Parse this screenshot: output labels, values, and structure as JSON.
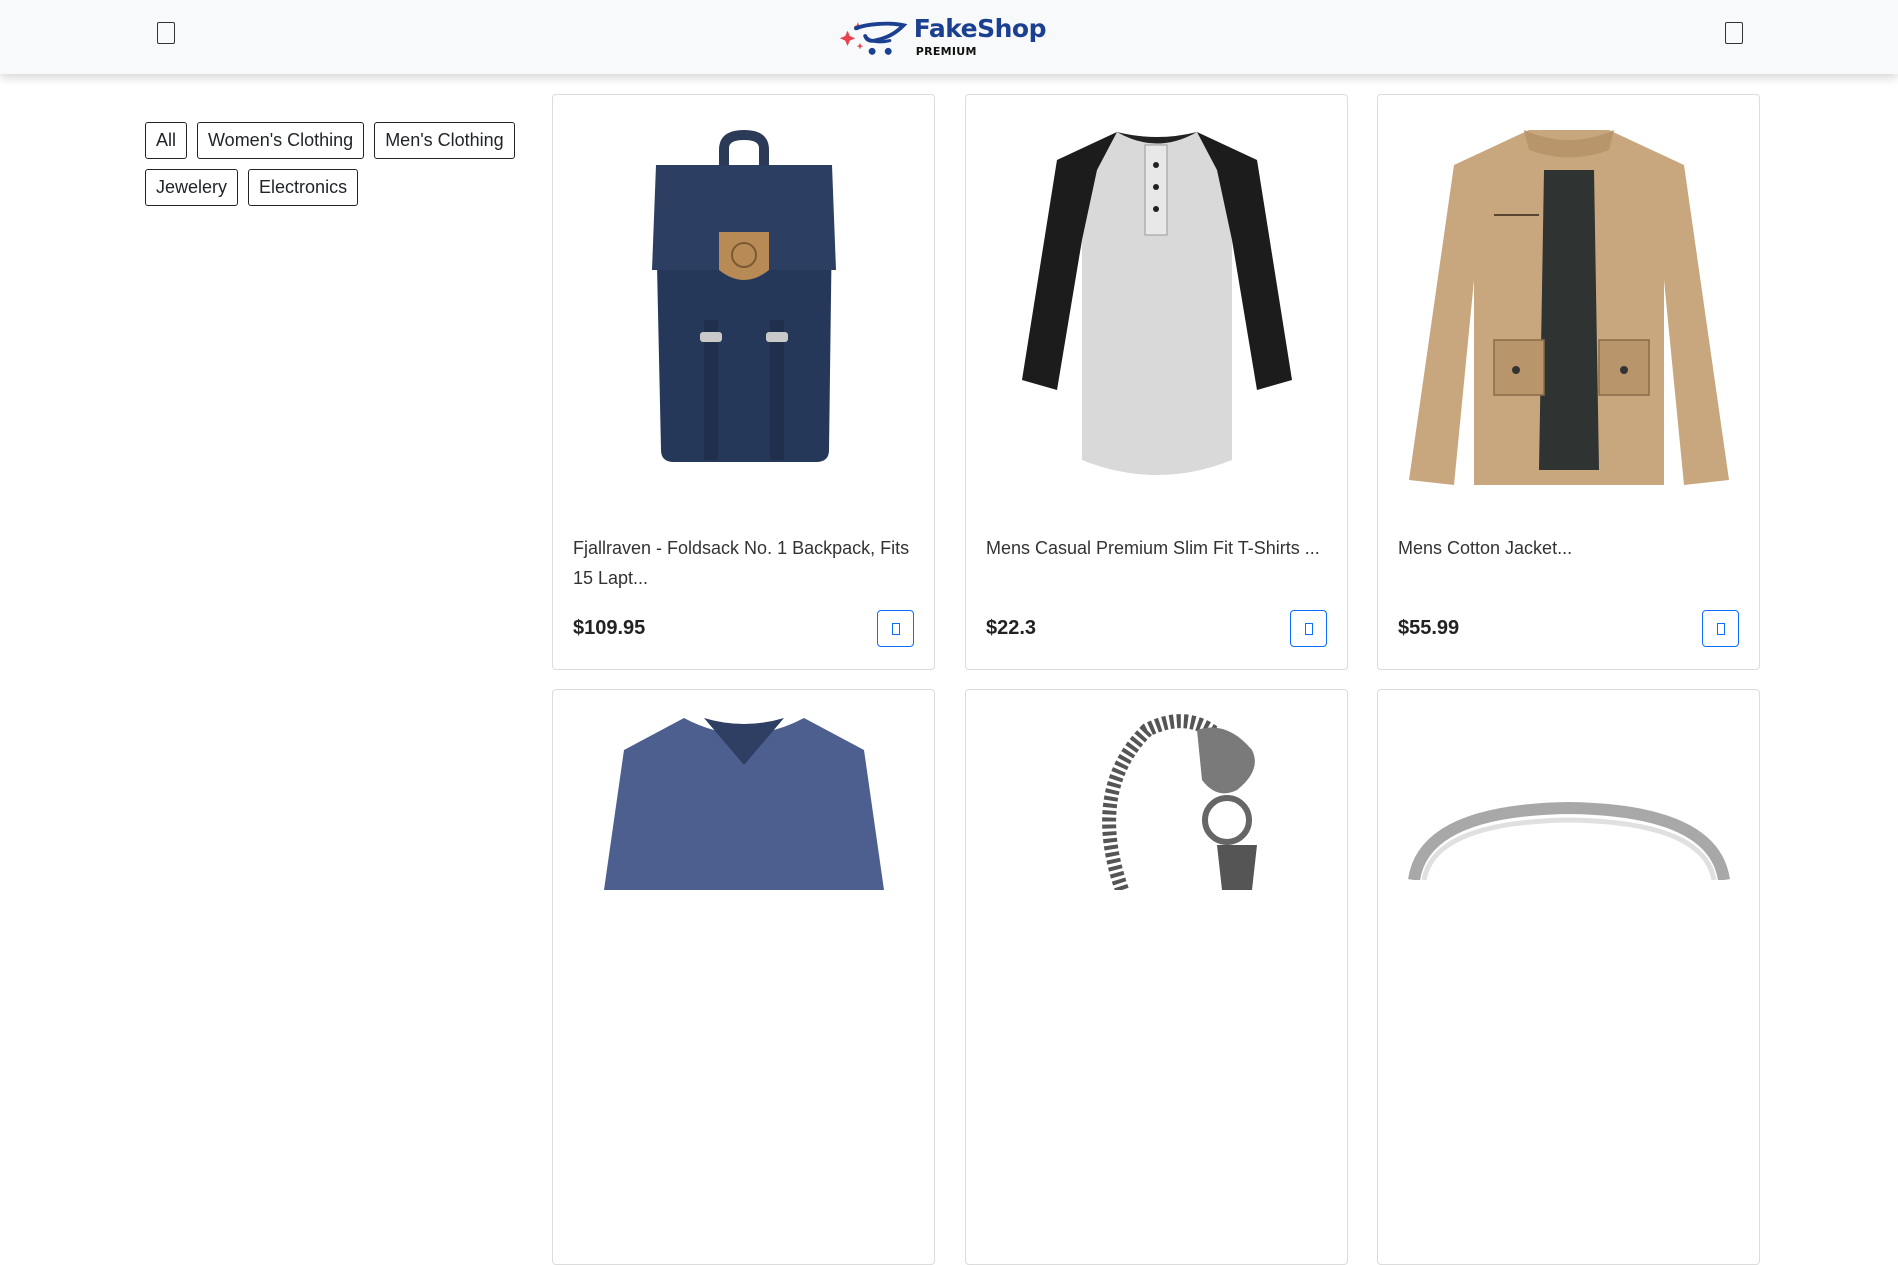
{
  "header": {
    "brand_name": "FakeShop",
    "brand_tagline": "PREMIUM",
    "menu_icon": "menu-icon",
    "cart_icon": "cart-icon",
    "brand_colors": {
      "primary": "#1b3f91",
      "accent": "#e8434d"
    }
  },
  "filters": [
    {
      "label": "All"
    },
    {
      "label": "Women's Clothing"
    },
    {
      "label": "Men's Clothing"
    },
    {
      "label": "Jewelery"
    },
    {
      "label": "Electronics"
    }
  ],
  "products": [
    {
      "title": "Fjallraven - Foldsack No. 1 Backpack, Fits 15 Lapt...",
      "price": "$109.95",
      "image": "navy-backpack"
    },
    {
      "title": "Mens Casual Premium Slim Fit T-Shirts ...",
      "price": "$22.3",
      "image": "raglan-henley-shirt"
    },
    {
      "title": "Mens Cotton Jacket...",
      "price": "$55.99",
      "image": "khaki-jacket"
    },
    {
      "title": "",
      "price": "",
      "image": "blue-vneck-sweater"
    },
    {
      "title": "",
      "price": "",
      "image": "dragon-chain-bracelet"
    },
    {
      "title": "",
      "price": "",
      "image": "silver-ring"
    }
  ],
  "accent_color": "#0d6efd"
}
